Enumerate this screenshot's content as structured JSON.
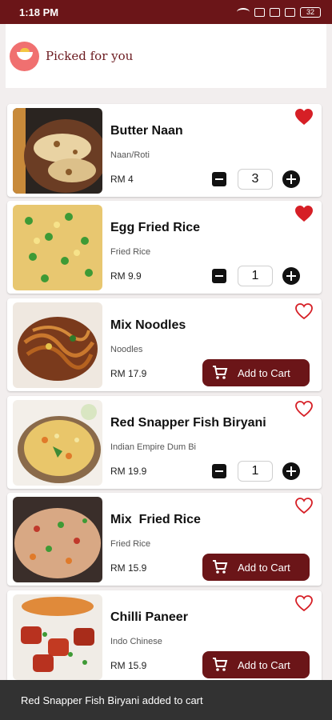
{
  "status_bar": {
    "time": "1:18 PM",
    "battery": "32"
  },
  "header": {
    "title": "Picked for you",
    "logo_icon": "dish-logo-icon"
  },
  "colors": {
    "brand": "#6b1518",
    "heart": "#d61f26",
    "snackbar": "#323232"
  },
  "items": [
    {
      "name": "Butter Naan",
      "category": "Naan/Roti",
      "price": "RM 4",
      "favorite": true,
      "control": "stepper",
      "quantity": "3"
    },
    {
      "name": "Egg Fried Rice",
      "category": "Fried Rice",
      "price": "RM 9.9",
      "favorite": true,
      "control": "stepper",
      "quantity": "1"
    },
    {
      "name": "Mix Noodles",
      "category": "Noodles",
      "price": "RM 17.9",
      "favorite": false,
      "control": "add",
      "add_label": "Add to Cart"
    },
    {
      "name": "Red Snapper Fish Biryani",
      "category": "Indian Empire Dum Bi",
      "price": "RM 19.9",
      "favorite": false,
      "control": "stepper",
      "quantity": "1"
    },
    {
      "name": "Mix  Fried Rice",
      "category": "Fried Rice",
      "price": "RM 15.9",
      "favorite": false,
      "control": "add",
      "add_label": "Add to Cart"
    },
    {
      "name": "Chilli Paneer",
      "category": "Indo Chinese",
      "price": "RM 15.9",
      "favorite": false,
      "control": "add",
      "add_label": "Add to Cart"
    }
  ],
  "snackbar": {
    "message": "Red Snapper Fish Biryani added to cart"
  }
}
